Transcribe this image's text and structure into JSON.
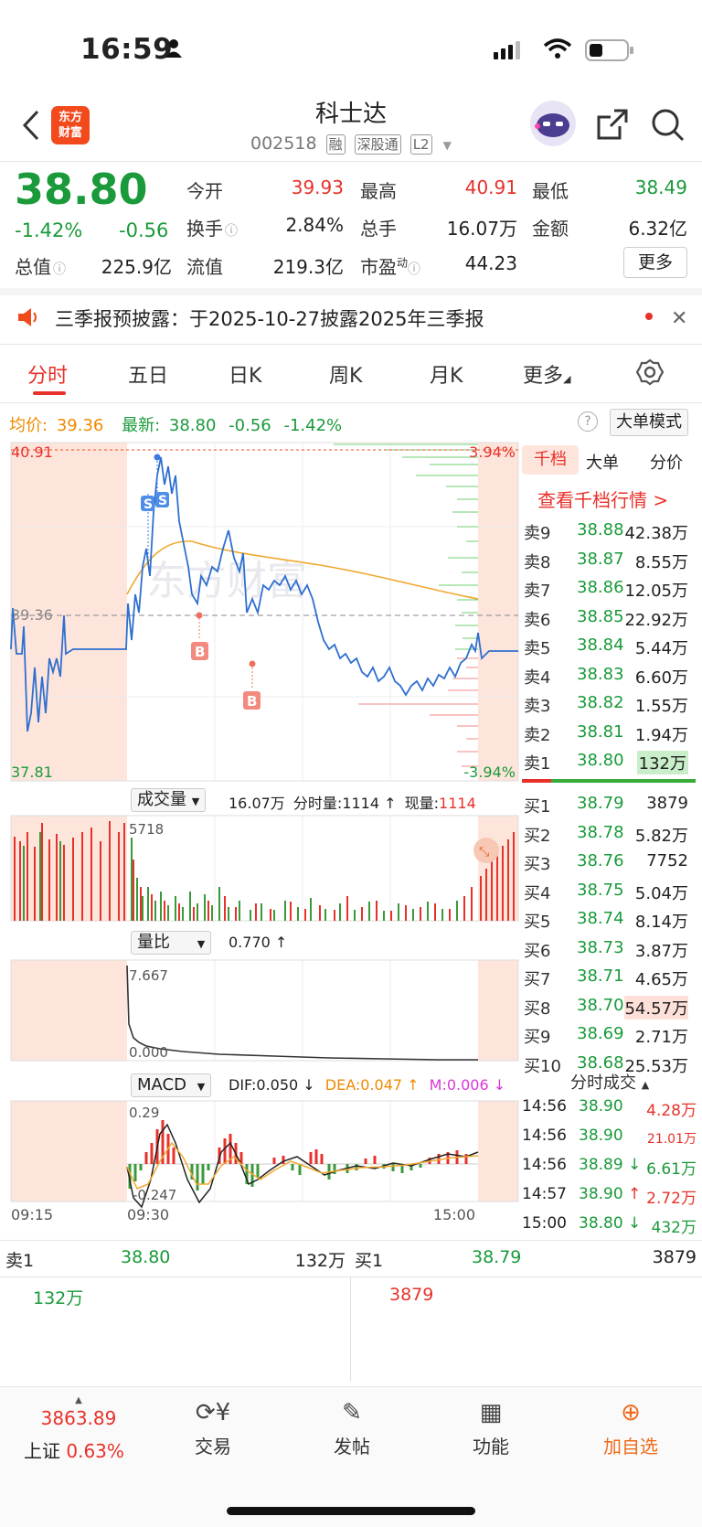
{
  "status_bar": {
    "time": "16:59"
  },
  "header": {
    "logo_line1": "东方",
    "logo_line2": "财富",
    "title": "科士达",
    "code": "002518",
    "tags": [
      "融",
      "深股通",
      "L2"
    ]
  },
  "quote": {
    "price": "38.80",
    "change_pct": "-1.42%",
    "change": "-0.56",
    "fields": [
      {
        "label": "今开",
        "value": "39.93",
        "color": "red"
      },
      {
        "label": "最高",
        "value": "40.91",
        "color": "red"
      },
      {
        "label": "最低",
        "value": "38.49",
        "color": "green"
      },
      {
        "label": "换手",
        "value": "2.84%",
        "color": "black"
      },
      {
        "label": "总手",
        "value": "16.07万",
        "color": "black"
      },
      {
        "label": "金额",
        "value": "6.32亿",
        "color": "black"
      },
      {
        "label": "总值",
        "value": "225.9亿",
        "color": "black"
      },
      {
        "label": "流值",
        "value": "219.3亿",
        "color": "black"
      },
      {
        "label": "市盈",
        "label_sup": "动",
        "value": "44.23",
        "color": "black"
      }
    ],
    "more_label": "更多"
  },
  "notice": {
    "text": "三季报预披露：于2025-10-27披露2025年三季报"
  },
  "tabs": [
    "分时",
    "五日",
    "日K",
    "周K",
    "月K",
    "更多"
  ],
  "chart_header": {
    "avg_label": "均价:",
    "avg_value": "39.36",
    "latest_label": "最新:",
    "latest_value": "38.80",
    "latest_change": "-0.56",
    "latest_pct": "-1.42%",
    "big_order_mode": "大单模式"
  },
  "chart_labels": {
    "high": "40.91",
    "mid": "39.36",
    "low": "37.81",
    "pct_high": "3.94%",
    "pct_low": "-3.94%",
    "signal_b": "B",
    "signal_s": "S"
  },
  "volume_panel": {
    "selector": "成交量",
    "total": "16.07万",
    "minute_label": "分时量:",
    "minute_value": "1114 ↑",
    "current_label": "现量:",
    "current_value": "1114",
    "max_label": "5718"
  },
  "ratio_panel": {
    "selector": "量比",
    "value": "0.770 ↑",
    "max": "7.667",
    "min": "0.000"
  },
  "macd_panel": {
    "selector": "MACD",
    "dif": "DIF:0.050 ↓",
    "dea": "DEA:0.047 ↑",
    "m": "M:0.006 ↓",
    "max": "0.29",
    "min": "-0.247"
  },
  "time_axis": [
    "09:15",
    "09:30",
    "15:00"
  ],
  "order_book": {
    "tabs": [
      "千档",
      "大单",
      "分价"
    ],
    "link": "查看千档行情 >",
    "asks": [
      {
        "label": "卖9",
        "price": "38.88",
        "vol": "42.38万"
      },
      {
        "label": "卖8",
        "price": "38.87",
        "vol": "8.55万"
      },
      {
        "label": "卖7",
        "price": "38.86",
        "vol": "12.05万"
      },
      {
        "label": "卖6",
        "price": "38.85",
        "vol": "22.92万"
      },
      {
        "label": "卖5",
        "price": "38.84",
        "vol": "5.44万"
      },
      {
        "label": "卖4",
        "price": "38.83",
        "vol": "6.60万"
      },
      {
        "label": "卖3",
        "price": "38.82",
        "vol": "1.55万"
      },
      {
        "label": "卖2",
        "price": "38.81",
        "vol": "1.94万"
      },
      {
        "label": "卖1",
        "price": "38.80",
        "vol": "132万"
      }
    ],
    "bids": [
      {
        "label": "买1",
        "price": "38.79",
        "vol": "3879"
      },
      {
        "label": "买2",
        "price": "38.78",
        "vol": "5.82万"
      },
      {
        "label": "买3",
        "price": "38.76",
        "vol": "7752"
      },
      {
        "label": "买4",
        "price": "38.75",
        "vol": "5.04万"
      },
      {
        "label": "买5",
        "price": "38.74",
        "vol": "8.14万"
      },
      {
        "label": "买6",
        "price": "38.73",
        "vol": "3.87万"
      },
      {
        "label": "买7",
        "price": "38.71",
        "vol": "4.65万"
      },
      {
        "label": "买8",
        "price": "38.70",
        "vol": "54.57万"
      },
      {
        "label": "买9",
        "price": "38.69",
        "vol": "2.71万"
      },
      {
        "label": "买10",
        "price": "38.68",
        "vol": "25.53万"
      }
    ]
  },
  "trades": {
    "header": "分时成交",
    "rows": [
      {
        "time": "14:56",
        "price": "38.90",
        "vol": "4.28万",
        "dir": ""
      },
      {
        "time": "14:56",
        "price": "38.90",
        "vol": "21.01万",
        "dir": ""
      },
      {
        "time": "14:56",
        "price": "38.89",
        "vol": "6.61万",
        "dir": "↓"
      },
      {
        "time": "14:57",
        "price": "38.90",
        "vol": "2.72万",
        "dir": "↑"
      },
      {
        "time": "15:00",
        "price": "38.80",
        "vol": "432万",
        "dir": "↓"
      }
    ]
  },
  "bottom_quote": {
    "sell_label": "卖1",
    "sell_price": "38.80",
    "sell_vol": "132万",
    "buy_label": "买1",
    "buy_price": "38.79",
    "buy_vol": "3879",
    "sell_detail": "132万",
    "buy_detail": "3879"
  },
  "bottom_nav": {
    "index_value": "3863.89",
    "index_name": "上证",
    "index_pct": "0.63%",
    "items": [
      "交易",
      "发帖",
      "功能",
      "加自选"
    ]
  },
  "watermark": "东方财富"
}
